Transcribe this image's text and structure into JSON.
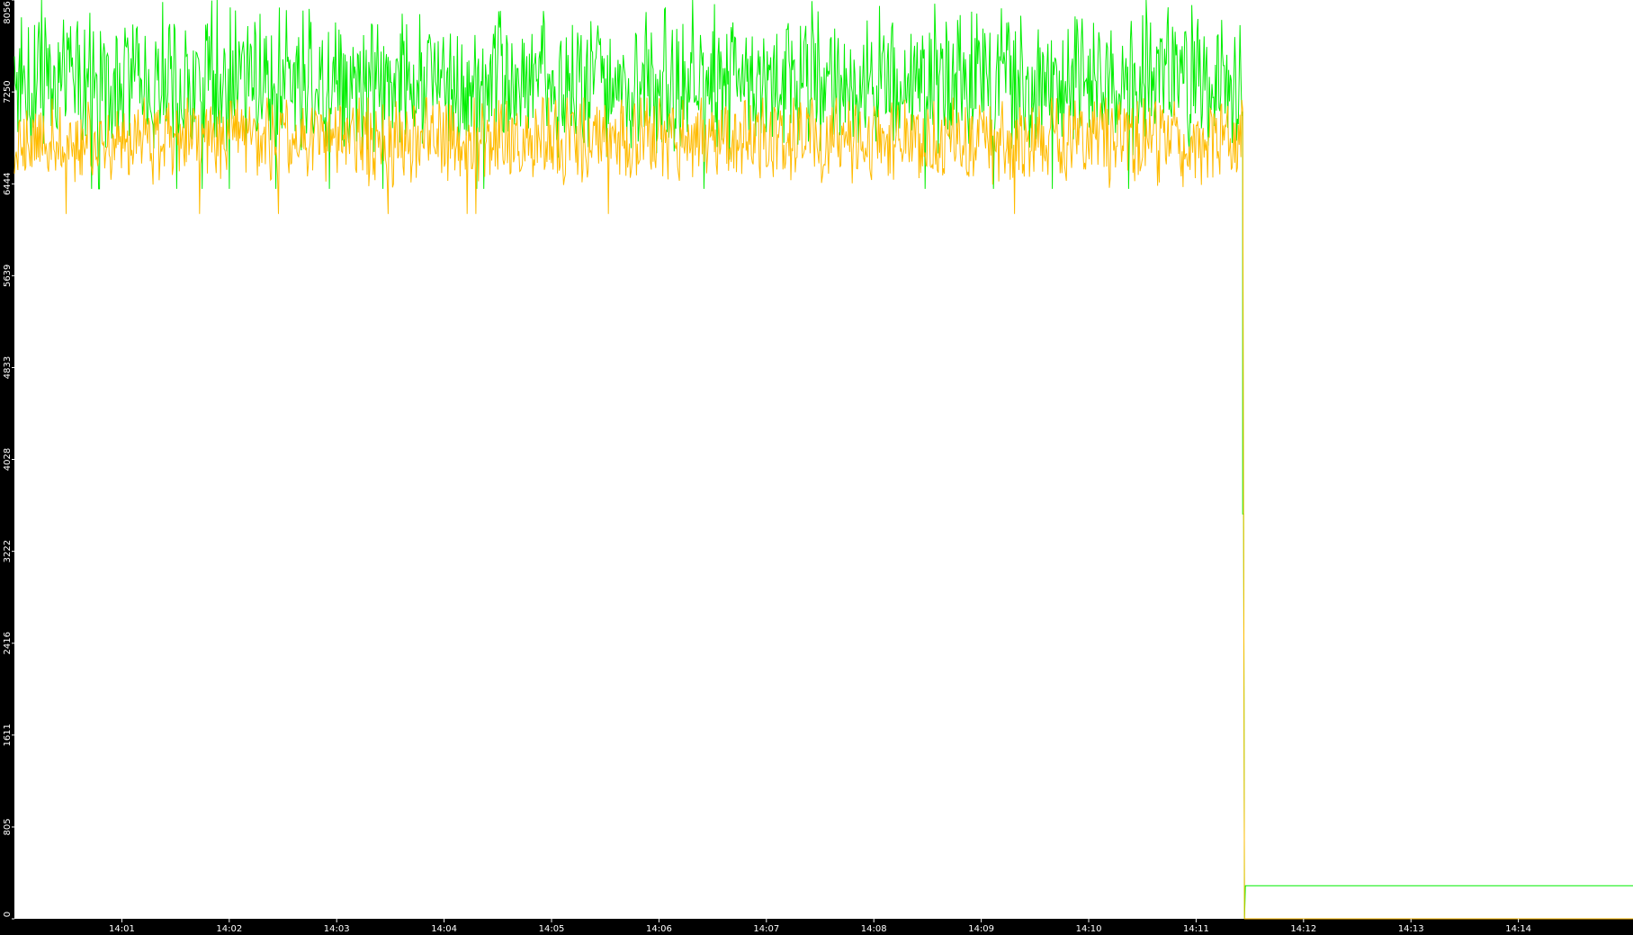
{
  "chart_data": {
    "type": "line",
    "title": "",
    "xlabel": "",
    "ylabel": "",
    "background_color": "#ffffff",
    "axis_band_color": "#000000",
    "tick_label_color": "#ffffff",
    "grid": false,
    "ylim": [
      0,
      8056
    ],
    "yticks": [
      0,
      805,
      1611,
      2416,
      3222,
      4028,
      4833,
      5639,
      6444,
      7250,
      8056
    ],
    "ytick_labels": [
      "0",
      "805",
      "1611",
      "2416",
      "3222",
      "4028",
      "4833",
      "5639",
      "6444",
      "7250",
      "8056"
    ],
    "xlim": [
      "14:00:00",
      "14:15:04"
    ],
    "xticks": [
      "14:01",
      "14:02",
      "14:03",
      "14:04",
      "14:05",
      "14:06",
      "14:07",
      "14:08",
      "14:09",
      "14:10",
      "14:11",
      "14:12",
      "14:13",
      "14:14"
    ],
    "series": [
      {
        "color": "#00ee00",
        "approx_mean": 7350,
        "approx_min": 6400,
        "approx_max": 8056,
        "until": "14:11:26",
        "drop_to": 3550,
        "after_value": 290
      },
      {
        "color": "#ffbb00",
        "approx_mean": 6830,
        "approx_min": 6180,
        "approx_max": 7200,
        "until": "14:11:26",
        "after_value": 0
      }
    ]
  }
}
